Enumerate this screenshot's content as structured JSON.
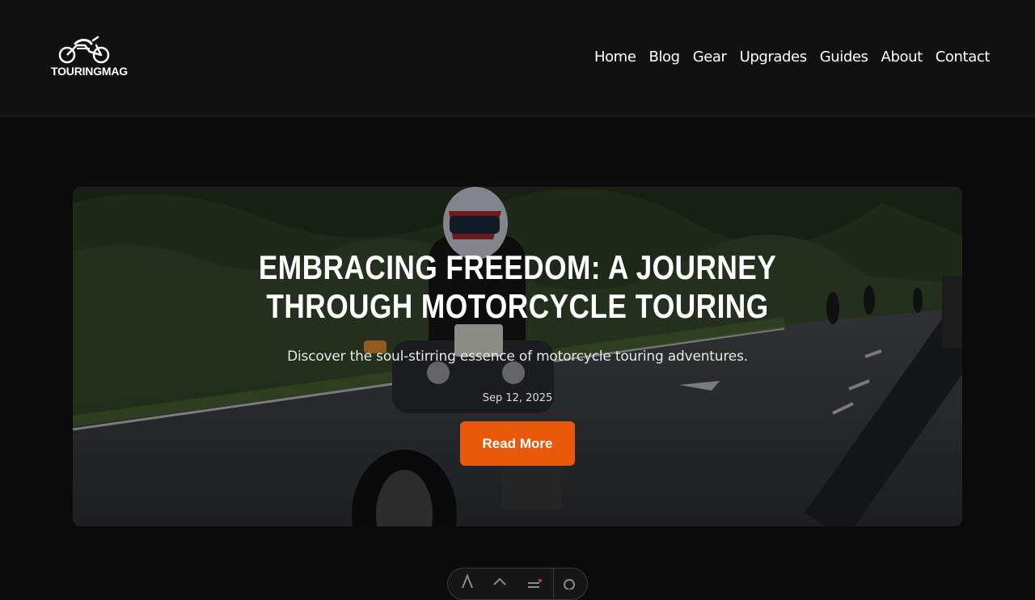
{
  "brand": {
    "name": "TOURINGMAG",
    "logo_icon": "motorcycle-icon"
  },
  "nav": {
    "items": [
      {
        "label": "Home"
      },
      {
        "label": "Blog"
      },
      {
        "label": "Gear"
      },
      {
        "label": "Upgrades"
      },
      {
        "label": "Guides"
      },
      {
        "label": "About"
      },
      {
        "label": "Contact"
      }
    ]
  },
  "hero": {
    "title": "Embracing Freedom: A Journey Through Motorcycle Touring",
    "subtitle": "Discover the soul-stirring essence of motorcycle touring adventures.",
    "date": "Sep 12, 2025",
    "button_label": "Read More",
    "accent_color": "#e8590c"
  },
  "toolbar": {
    "icons": [
      "inspect-icon",
      "select-icon",
      "menu-icon",
      "settings-icon"
    ]
  }
}
